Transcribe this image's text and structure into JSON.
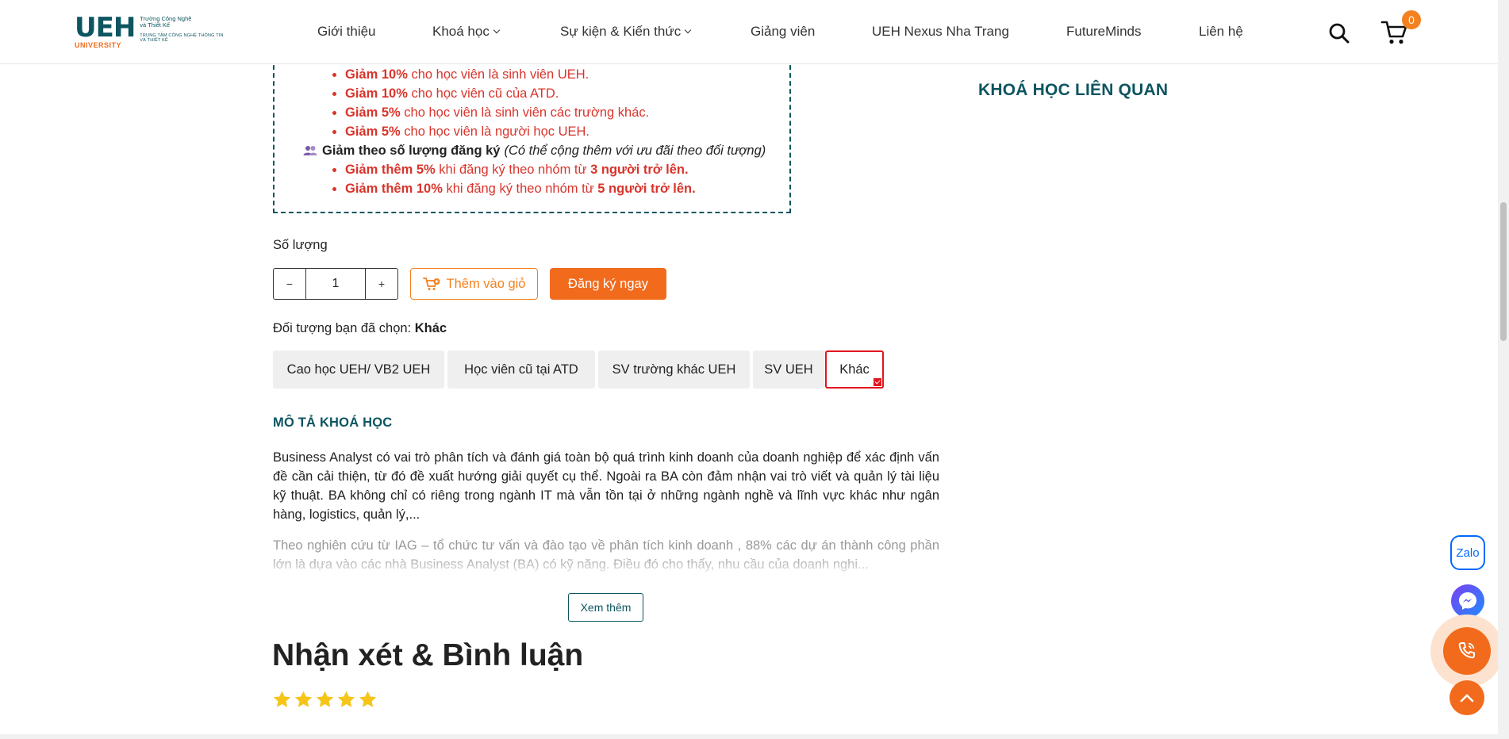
{
  "header": {
    "logo": {
      "main": "UEH",
      "sub": "UNIVERSITY",
      "side_line1": "Trường Công Nghệ",
      "side_line2": "và Thiết Kế",
      "side_line3": "TRUNG TÂM CÔNG NGHỆ THÔNG TIN VÀ THIẾT KẾ"
    },
    "nav": [
      {
        "label": "Giới thiệu",
        "has_dropdown": false
      },
      {
        "label": "Khoá học",
        "has_dropdown": true
      },
      {
        "label": "Sự kiện & Kiến thức",
        "has_dropdown": true
      },
      {
        "label": "Giảng viên",
        "has_dropdown": false
      },
      {
        "label": "UEH Nexus Nha Trang",
        "has_dropdown": false
      },
      {
        "label": "FutureMinds",
        "has_dropdown": false
      },
      {
        "label": "Liên hệ",
        "has_dropdown": false
      }
    ],
    "search_icon": "search-icon",
    "cart_icon": "cart-icon",
    "cart_count": "0"
  },
  "promo": {
    "items_group1": [
      {
        "bold": "Giảm 10%",
        "text": " cho học viên là sinh viên UEH."
      },
      {
        "bold": "Giảm 10%",
        "text": " cho học viên cũ của ATD."
      },
      {
        "bold": "Giảm 5%",
        "text": " cho học viên là sinh viên các trường khác."
      },
      {
        "bold": "Giảm 5%",
        "text": " cho học viên là người học UEH."
      }
    ],
    "group2_title": "Giảm theo số lượng đăng ký",
    "group2_note": "(Có thể cộng thêm với ưu đãi theo đối tượng)",
    "items_group2": [
      {
        "bold": "Giảm thêm 5%",
        "text": " khi đăng ký theo nhóm từ ",
        "bold2": "3 người trở lên."
      },
      {
        "bold": "Giảm thêm 10%",
        "text": " khi đăng ký theo nhóm từ ",
        "bold2": "5 người trở lên."
      }
    ]
  },
  "quantity": {
    "label": "Số lượng",
    "minus": "−",
    "value": "1",
    "plus": "+"
  },
  "actions": {
    "add_to_cart": "Thêm vào giỏ",
    "register_now": "Đăng ký ngay"
  },
  "audience": {
    "label": "Đối tượng bạn đã chọn: ",
    "selected": "Khác",
    "options": [
      "Cao học UEH/ VB2 UEH",
      "Học viên cũ tại ATD",
      "SV trường khác UEH",
      "SV UEH",
      "Khác"
    ],
    "active_index": 4
  },
  "description": {
    "title": "MÔ TẢ KHOÁ HỌC",
    "p1": "Business Analyst có vai trò phân tích và đánh giá toàn bộ quá trình kinh doanh của doanh nghiệp để xác định vấn đề cần cải thiện, từ đó đề xuất hướng giải quyết cụ thể. Ngoài ra BA còn đảm nhận vai trò viết và quản lý tài liệu kỹ thuật. BA không chỉ có riêng trong ngành IT mà vẫn tồn tại ở những ngành nghề và lĩnh vực khác như ngân hàng, logistics, quản lý,...",
    "p2": "Theo nghiên cứu từ IAG – tổ chức tư vấn và đào tạo về phân tích kinh doanh , 88% các dự án thành công phần lớn là dựa vào các nhà Business Analyst (BA) có kỹ năng. Điều đó cho thấy, nhu cầu của doanh nghi...",
    "more_button": "Xem thêm"
  },
  "reviews": {
    "title": "Nhận xét & Bình luận",
    "rating": 5,
    "max_rating": 5
  },
  "sidebar": {
    "related_title": "KHOÁ HỌC LIÊN QUAN"
  },
  "floating": {
    "zalo_label": "Zalo",
    "messenger_icon": "messenger-icon",
    "phone_icon": "phone-icon",
    "to_top_icon": "chevron-up-icon"
  },
  "colors": {
    "brand": "#0d5560",
    "accent": "#f26b1d",
    "promo_red": "#d9342b",
    "selected_border": "#e0161e",
    "star": "#f5c518"
  }
}
